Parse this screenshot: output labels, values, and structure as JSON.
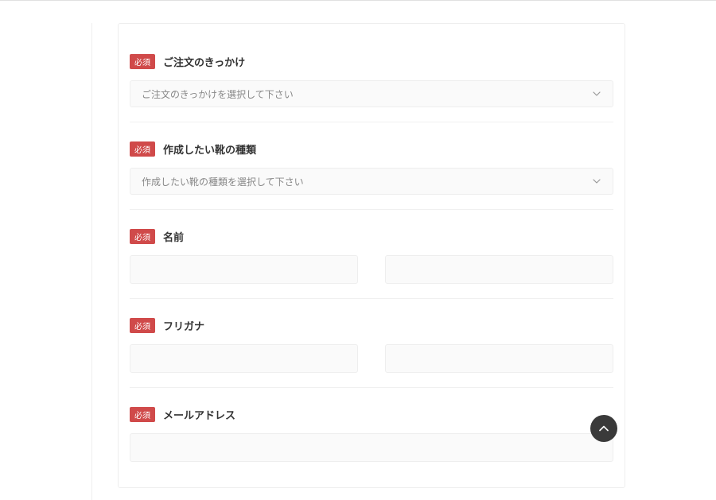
{
  "form": {
    "required_label": "必須",
    "fields": {
      "order_reason": {
        "label": "ご注文のきっかけ",
        "placeholder": "ご注文のきっかけを選択して下さい"
      },
      "shoe_type": {
        "label": "作成したい靴の種類",
        "placeholder": "作成したい靴の種類を選択して下さい"
      },
      "name": {
        "label": "名前"
      },
      "furigana": {
        "label": "フリガナ"
      },
      "email": {
        "label": "メールアドレス"
      }
    }
  }
}
